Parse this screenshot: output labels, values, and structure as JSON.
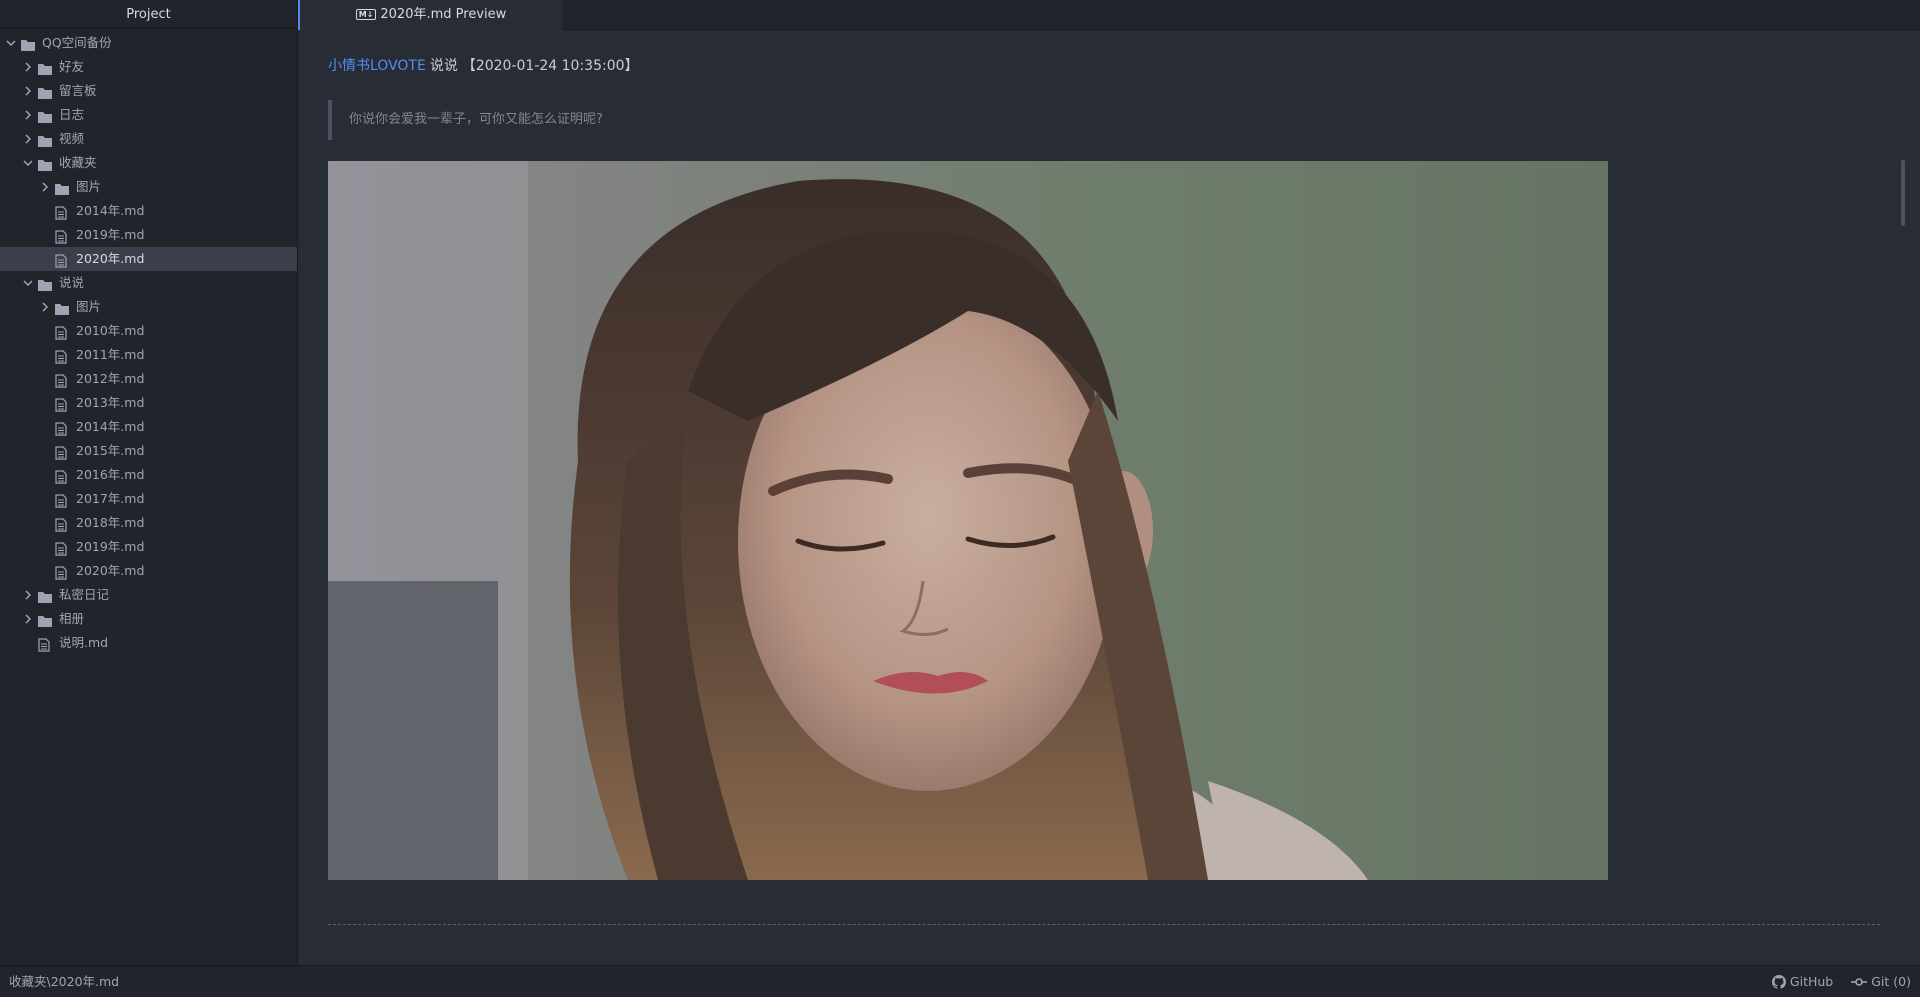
{
  "sidebar": {
    "title": "Project",
    "tree": [
      {
        "label": "QQ空间备份",
        "type": "folder",
        "level": 0,
        "expanded": true
      },
      {
        "label": "好友",
        "type": "folder",
        "level": 1,
        "expanded": false
      },
      {
        "label": "留言板",
        "type": "folder",
        "level": 1,
        "expanded": false
      },
      {
        "label": "日志",
        "type": "folder",
        "level": 1,
        "expanded": false
      },
      {
        "label": "视频",
        "type": "folder",
        "level": 1,
        "expanded": false
      },
      {
        "label": "收藏夹",
        "type": "folder",
        "level": 1,
        "expanded": true
      },
      {
        "label": "图片",
        "type": "folder",
        "level": 2,
        "expanded": false
      },
      {
        "label": "2014年.md",
        "type": "file",
        "level": 2
      },
      {
        "label": "2019年.md",
        "type": "file",
        "level": 2
      },
      {
        "label": "2020年.md",
        "type": "file",
        "level": 2,
        "selected": true
      },
      {
        "label": "说说",
        "type": "folder",
        "level": 1,
        "expanded": true
      },
      {
        "label": "图片",
        "type": "folder",
        "level": 2,
        "expanded": false
      },
      {
        "label": "2010年.md",
        "type": "file",
        "level": 2
      },
      {
        "label": "2011年.md",
        "type": "file",
        "level": 2
      },
      {
        "label": "2012年.md",
        "type": "file",
        "level": 2
      },
      {
        "label": "2013年.md",
        "type": "file",
        "level": 2
      },
      {
        "label": "2014年.md",
        "type": "file",
        "level": 2
      },
      {
        "label": "2015年.md",
        "type": "file",
        "level": 2
      },
      {
        "label": "2016年.md",
        "type": "file",
        "level": 2
      },
      {
        "label": "2017年.md",
        "type": "file",
        "level": 2
      },
      {
        "label": "2018年.md",
        "type": "file",
        "level": 2
      },
      {
        "label": "2019年.md",
        "type": "file",
        "level": 2
      },
      {
        "label": "2020年.md",
        "type": "file",
        "level": 2
      },
      {
        "label": "私密日记",
        "type": "folder",
        "level": 1,
        "expanded": false
      },
      {
        "label": "相册",
        "type": "folder",
        "level": 1,
        "expanded": false
      },
      {
        "label": "说明.md",
        "type": "file",
        "level": 1
      }
    ]
  },
  "tab": {
    "badge": "M↓",
    "title": "2020年.md Preview"
  },
  "post": {
    "author": "小情书LOVOTE",
    "type": "说说",
    "timestamp": "【2020-01-24 10:35:00】",
    "quote": "你说你会爱我一辈子，可你又能怎么证明呢?"
  },
  "statusbar": {
    "path": "收藏夹\\2020年.md",
    "github_label": "GitHub",
    "git_label": "Git (0)"
  },
  "colors": {
    "accent": "#568af2",
    "background": "#282c34",
    "sidebar": "#21252b",
    "selection": "#3a3f4b"
  },
  "icons": [
    "chevron-right-icon",
    "chevron-down-icon",
    "folder-icon",
    "file-text-icon",
    "github-icon",
    "git-commit-icon"
  ]
}
